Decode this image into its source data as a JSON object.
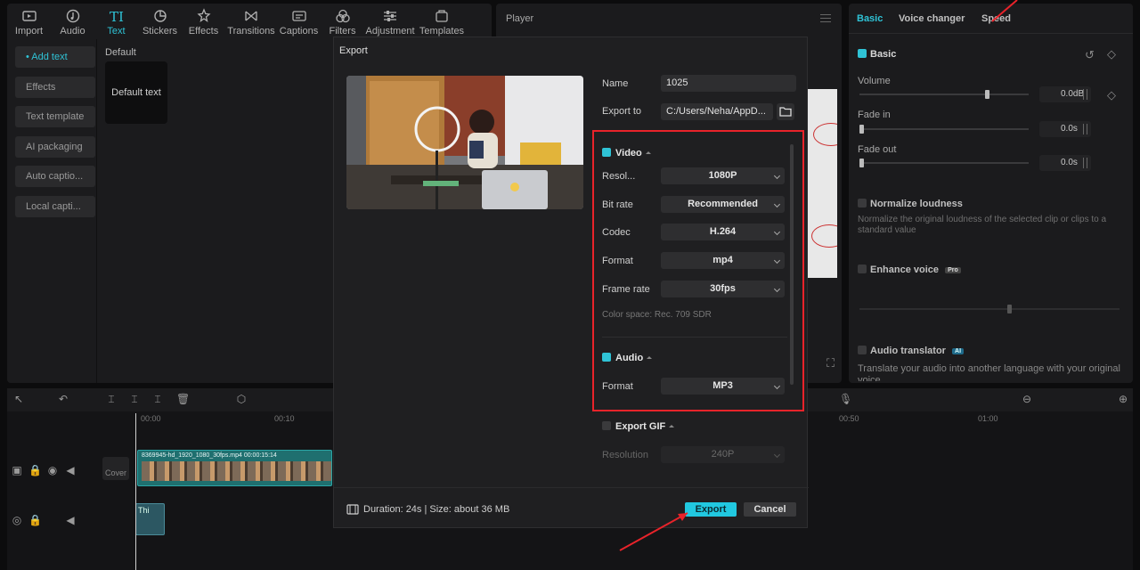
{
  "toolbar": {
    "items": [
      {
        "label": "Import",
        "icon": "import-icon"
      },
      {
        "label": "Audio",
        "icon": "audio-icon"
      },
      {
        "label": "Text",
        "icon": "text-icon",
        "active": true
      },
      {
        "label": "Stickers",
        "icon": "stickers-icon"
      },
      {
        "label": "Effects",
        "icon": "effects-icon"
      },
      {
        "label": "Transitions",
        "icon": "transitions-icon"
      },
      {
        "label": "Captions",
        "icon": "captions-icon"
      },
      {
        "label": "Filters",
        "icon": "filters-icon"
      },
      {
        "label": "Adjustment",
        "icon": "adjustment-icon"
      },
      {
        "label": "Templates",
        "icon": "templates-icon"
      }
    ]
  },
  "media": {
    "categories": [
      "• Add text",
      "Effects",
      "Text template",
      "AI packaging",
      "Auto captio...",
      "Local capti..."
    ],
    "section_label": "Default",
    "tile_label": "Default text"
  },
  "player": {
    "title": "Player"
  },
  "props": {
    "tabs": [
      "Basic",
      "Voice changer",
      "Speed"
    ],
    "basic_label": "Basic",
    "volume_label": "Volume",
    "volume_value": "0.0dB",
    "volume_level": 0.75,
    "fade_in_label": "Fade in",
    "fade_in_value": "0.0s",
    "fade_out_label": "Fade out",
    "fade_out_value": "0.0s",
    "normalize_label": "Normalize loudness",
    "normalize_desc": "Normalize the original loudness of the selected clip or clips to a standard value",
    "enhance_label": "Enhance voice",
    "enhance_badge": "Pro",
    "translator_label": "Audio translator",
    "translator_badge": "AI",
    "translator_desc": "Translate your audio into another language with your original voice"
  },
  "timeline": {
    "ruler": [
      "00:00",
      "00:10",
      "00:50",
      "01:00"
    ],
    "clip_label": "8369945-hd_1920_1080_30fps.mp4  00:00:15:14",
    "cover_label": "Cover",
    "text_clip_label": "Thi"
  },
  "export_dialog": {
    "title": "Export",
    "name_label": "Name",
    "name_value": "1025",
    "export_to_label": "Export to",
    "export_to_value": "C:/Users/Neha/AppD...",
    "video": {
      "label": "Video",
      "resolution_label": "Resol...",
      "resolution_value": "1080P",
      "bitrate_label": "Bit rate",
      "bitrate_value": "Recommended",
      "codec_label": "Codec",
      "codec_value": "H.264",
      "format_label": "Format",
      "format_value": "mp4",
      "framerate_label": "Frame rate",
      "framerate_value": "30fps",
      "color_space": "Color space: Rec. 709 SDR"
    },
    "audio": {
      "label": "Audio",
      "format_label": "Format",
      "format_value": "MP3"
    },
    "gif": {
      "label": "Export GIF",
      "resolution_label": "Resolution",
      "resolution_value": "240P"
    },
    "duration_text": "Duration: 24s | Size: about 36 MB",
    "export_label": "Export",
    "cancel_label": "Cancel"
  },
  "colors": {
    "accent": "#21c8e0",
    "highlight": "#e8232a"
  }
}
